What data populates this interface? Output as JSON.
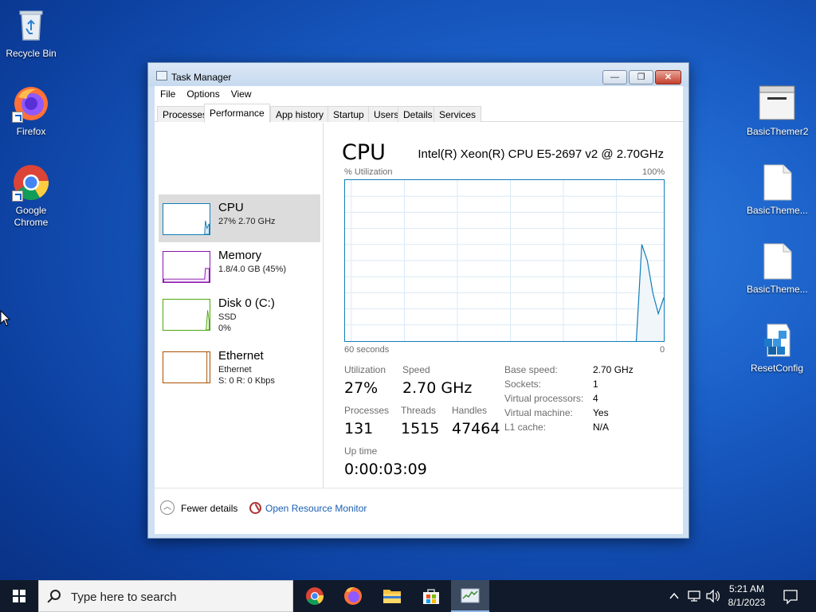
{
  "desktop": {
    "icons_left": [
      {
        "label": "Recycle Bin"
      },
      {
        "label": "Firefox"
      },
      {
        "label": "Google Chrome"
      }
    ],
    "icons_right": [
      {
        "label": "BasicThemer2"
      },
      {
        "label": "BasicTheme..."
      },
      {
        "label": "BasicTheme..."
      },
      {
        "label": "ResetConfig"
      }
    ]
  },
  "window": {
    "title": "Task Manager",
    "controls": {
      "minimize": "—",
      "restore": "❐",
      "close": "✕"
    },
    "menu": [
      "File",
      "Options",
      "View"
    ],
    "tabs": [
      "Processes",
      "Performance",
      "App history",
      "Startup",
      "Users",
      "Details",
      "Services"
    ],
    "active_tab": "Performance"
  },
  "resources": [
    {
      "name": "CPU",
      "sub1": "27%  2.70 GHz",
      "sub2": "",
      "color": "#117dbb"
    },
    {
      "name": "Memory",
      "sub1": "1.8/4.0 GB (45%)",
      "sub2": "",
      "color": "#8b12ae"
    },
    {
      "name": "Disk 0 (C:)",
      "sub1": "SSD",
      "sub2": "0%",
      "color": "#4da60c"
    },
    {
      "name": "Ethernet",
      "sub1": "Ethernet",
      "sub2": "S: 0  R: 0 Kbps",
      "color": "#a74f01"
    }
  ],
  "cpu": {
    "heading": "CPU",
    "model": "Intel(R) Xeon(R) CPU E5-2697 v2 @ 2.70GHz",
    "graph_top_left": "% Utilization",
    "graph_top_right": "100%",
    "graph_bottom_left": "60 seconds",
    "graph_bottom_right": "0",
    "utilization_series_pct": [
      0,
      0,
      0,
      0,
      0,
      0,
      0,
      0,
      0,
      0,
      0,
      0,
      0,
      0,
      0,
      0,
      0,
      0,
      0,
      0,
      0,
      0,
      0,
      0,
      0,
      0,
      0,
      0,
      0,
      0,
      0,
      0,
      0,
      0,
      0,
      0,
      0,
      0,
      0,
      0,
      0,
      0,
      0,
      0,
      0,
      0,
      0,
      0,
      0,
      0,
      0,
      0,
      0,
      0,
      60,
      50,
      30,
      17,
      27
    ]
  },
  "stats": {
    "utilization_label": "Utilization",
    "utilization": "27%",
    "speed_label": "Speed",
    "speed": "2.70 GHz",
    "processes_label": "Processes",
    "processes": "131",
    "threads_label": "Threads",
    "threads": "1515",
    "handles_label": "Handles",
    "handles": "47464",
    "uptime_label": "Up time",
    "uptime": "0:00:03:09"
  },
  "details": [
    {
      "label": "Base speed:",
      "value": "2.70 GHz"
    },
    {
      "label": "Sockets:",
      "value": "1"
    },
    {
      "label": "Virtual processors:",
      "value": "4"
    },
    {
      "label": "Virtual machine:",
      "value": "Yes"
    },
    {
      "label": "L1 cache:",
      "value": "N/A"
    }
  ],
  "footer": {
    "fewer_details": "Fewer details",
    "resource_monitor": "Open Resource Monitor"
  },
  "taskbar": {
    "search_placeholder": "Type here to search",
    "apps": [
      "chrome",
      "firefox",
      "file-explorer",
      "store",
      "task-manager"
    ],
    "clock_time": "5:21 AM",
    "clock_date": "8/1/2023"
  }
}
